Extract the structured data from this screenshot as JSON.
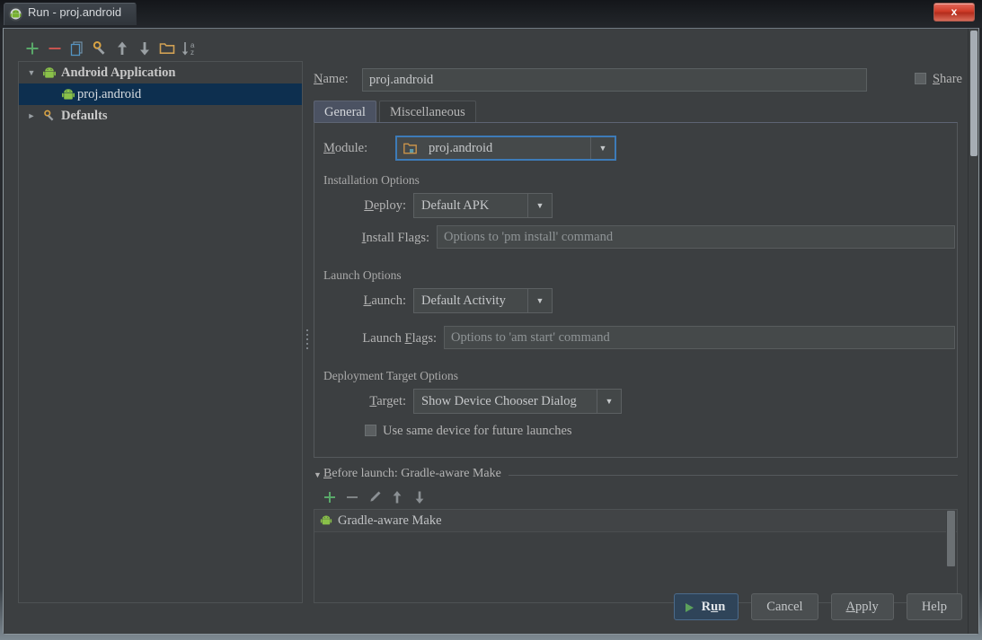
{
  "window": {
    "title": "Run - proj.android",
    "title_icon": "android-studio-icon",
    "close_label": "x"
  },
  "tree_toolbar": {
    "buttons": [
      {
        "name": "add-configuration-button",
        "icon": "plus-icon"
      },
      {
        "name": "remove-configuration-button",
        "icon": "minus-icon"
      },
      {
        "name": "copy-configuration-button",
        "icon": "copy-icon"
      },
      {
        "name": "edit-defaults-button",
        "icon": "wrench-icon"
      },
      {
        "name": "move-up-button",
        "icon": "arrow-up-icon"
      },
      {
        "name": "move-down-button",
        "icon": "arrow-down-icon"
      },
      {
        "name": "move-into-folder-button",
        "icon": "folder-icon"
      },
      {
        "name": "sort-configurations-button",
        "icon": "sort-az-icon"
      }
    ]
  },
  "tree": {
    "nodes": [
      {
        "label": "Android Application",
        "icon": "android-icon",
        "twisty": "▼",
        "depth": 0,
        "bold": true,
        "selected": false
      },
      {
        "label": "proj.android",
        "icon": "android-icon",
        "twisty": "",
        "depth": 1,
        "bold": false,
        "selected": true
      },
      {
        "label": "Defaults",
        "icon": "wrench-icon",
        "twisty": "►",
        "depth": 0,
        "bold": true,
        "selected": false
      }
    ]
  },
  "name_row": {
    "label": "Name:",
    "mnemonic": "N",
    "value": "proj.android",
    "share": {
      "label": "Share",
      "mnemonic": "S",
      "checked": false
    }
  },
  "tabs": [
    {
      "label": "General",
      "active": true
    },
    {
      "label": "Miscellaneous",
      "active": false
    }
  ],
  "module": {
    "label": "Module:",
    "mnemonic": "M",
    "value": "proj.android",
    "icon": "module-folder-icon",
    "focused": true,
    "arrow": "▼"
  },
  "installation_options": {
    "title": "Installation Options",
    "deploy": {
      "label": "Deploy:",
      "mnemonic": "D",
      "value": "Default APK",
      "arrow": "▼"
    },
    "install_flags": {
      "label": "Install Flags:",
      "mnemonic": "I",
      "value": "",
      "placeholder": "Options to 'pm install' command"
    }
  },
  "launch_options": {
    "title": "Launch Options",
    "launch": {
      "label": "Launch:",
      "mnemonic": "L",
      "value": "Default Activity",
      "arrow": "▼"
    },
    "launch_flags": {
      "label": "Launch Flags:",
      "mnemonic": "F",
      "value": "",
      "placeholder": "Options to 'am start' command"
    }
  },
  "deployment_target_options": {
    "title": "Deployment Target Options",
    "target": {
      "label": "Target:",
      "mnemonic": "T",
      "value": "Show Device Chooser Dialog",
      "arrow": "▼"
    },
    "same_device": {
      "label": "Use same device for future launches",
      "checked": false
    }
  },
  "before_launch": {
    "title": "Before launch: Gradle-aware Make",
    "mnemonic": "B",
    "twisty": "▼",
    "toolbar": [
      {
        "name": "add-task-button",
        "icon": "plus-icon"
      },
      {
        "name": "remove-task-button",
        "icon": "minus-icon"
      },
      {
        "name": "edit-task-button",
        "icon": "pencil-icon"
      },
      {
        "name": "task-move-up-button",
        "icon": "arrow-up-icon"
      },
      {
        "name": "task-move-down-button",
        "icon": "arrow-down-icon"
      }
    ],
    "items": [
      {
        "label": "Gradle-aware Make",
        "icon": "android-icon"
      }
    ]
  },
  "footer": {
    "run": "Run",
    "run_mnemonic": "u",
    "cancel": "Cancel",
    "apply": "Apply",
    "apply_mnemonic": "A",
    "help": "Help"
  },
  "colors": {
    "accent_blue": "#3d7bb8",
    "selection": "#0d2f4f",
    "panel_bg": "#3c3f41",
    "field_bg": "#45494a",
    "green": "#5ca05c",
    "red": "#cf3b28",
    "orange": "#c9934a"
  }
}
